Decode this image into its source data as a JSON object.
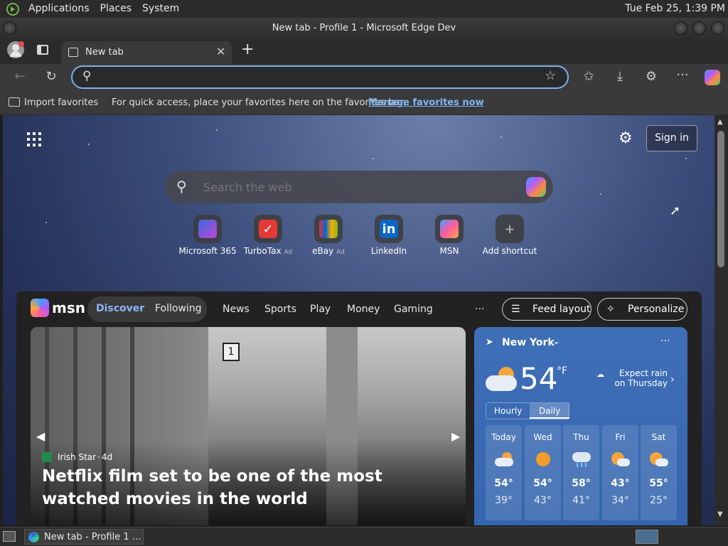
{
  "panel": {
    "applications": "Applications",
    "places": "Places",
    "system": "System",
    "clock": "Tue Feb 25,  1:39 PM"
  },
  "window": {
    "title": "New tab - Profile 1 - Microsoft Edge Dev"
  },
  "tabs": {
    "active_label": "New tab"
  },
  "toolbar": {
    "address_value": ""
  },
  "favbar": {
    "import_label": "Import favorites",
    "message": "For quick access, place your favorites here on the favorites bar.",
    "manage_link": "Manage favorites now"
  },
  "newtab": {
    "sign_in": "Sign in",
    "search_placeholder": "Search the web",
    "shortcuts": [
      {
        "label": "Microsoft 365",
        "ad": "",
        "icon": "microsoft365-icon"
      },
      {
        "label": "TurboTax",
        "ad": "Ad",
        "icon": "turbotax-icon"
      },
      {
        "label": "eBay",
        "ad": "Ad",
        "icon": "ebay-icon"
      },
      {
        "label": "LinkedIn",
        "ad": "",
        "icon": "linkedin-icon"
      },
      {
        "label": "MSN",
        "ad": "",
        "icon": "msn-icon"
      },
      {
        "label": "Add shortcut",
        "ad": "",
        "icon": "plus-icon"
      }
    ]
  },
  "msn": {
    "logo": "msn",
    "tabs": [
      "Discover",
      "Following"
    ],
    "nav": [
      "News",
      "Sports",
      "Play",
      "Money",
      "Gaming"
    ],
    "more": "···",
    "feed_layout": "Feed layout",
    "personalize": "Personalize",
    "hero": {
      "source": "Irish Star",
      "age": "4d",
      "headline": "Netflix film set to be one of the most watched movies in the world"
    },
    "weather": {
      "location": "New York",
      "temp": "54",
      "unit": "°F",
      "forecast_note": "Expect rain on Thursday",
      "tabs": [
        "Hourly",
        "Daily"
      ],
      "days": [
        {
          "day": "Today",
          "high": "54°",
          "low": "39°",
          "icon": "partly-cloudy-icon"
        },
        {
          "day": "Wed",
          "high": "54°",
          "low": "43°",
          "icon": "sunny-icon"
        },
        {
          "day": "Thu",
          "high": "58°",
          "low": "41°",
          "icon": "rain-icon"
        },
        {
          "day": "Fri",
          "high": "43°",
          "low": "34°",
          "icon": "partly-sunny-icon"
        },
        {
          "day": "Sat",
          "high": "55°",
          "low": "25°",
          "icon": "partly-sunny-icon"
        }
      ]
    }
  },
  "taskbar": {
    "item": "New tab - Profile 1 -..."
  },
  "colors": {
    "accent": "#7aaff5",
    "link": "#7cb7f7",
    "weather_bg": "#3a6bb3"
  }
}
